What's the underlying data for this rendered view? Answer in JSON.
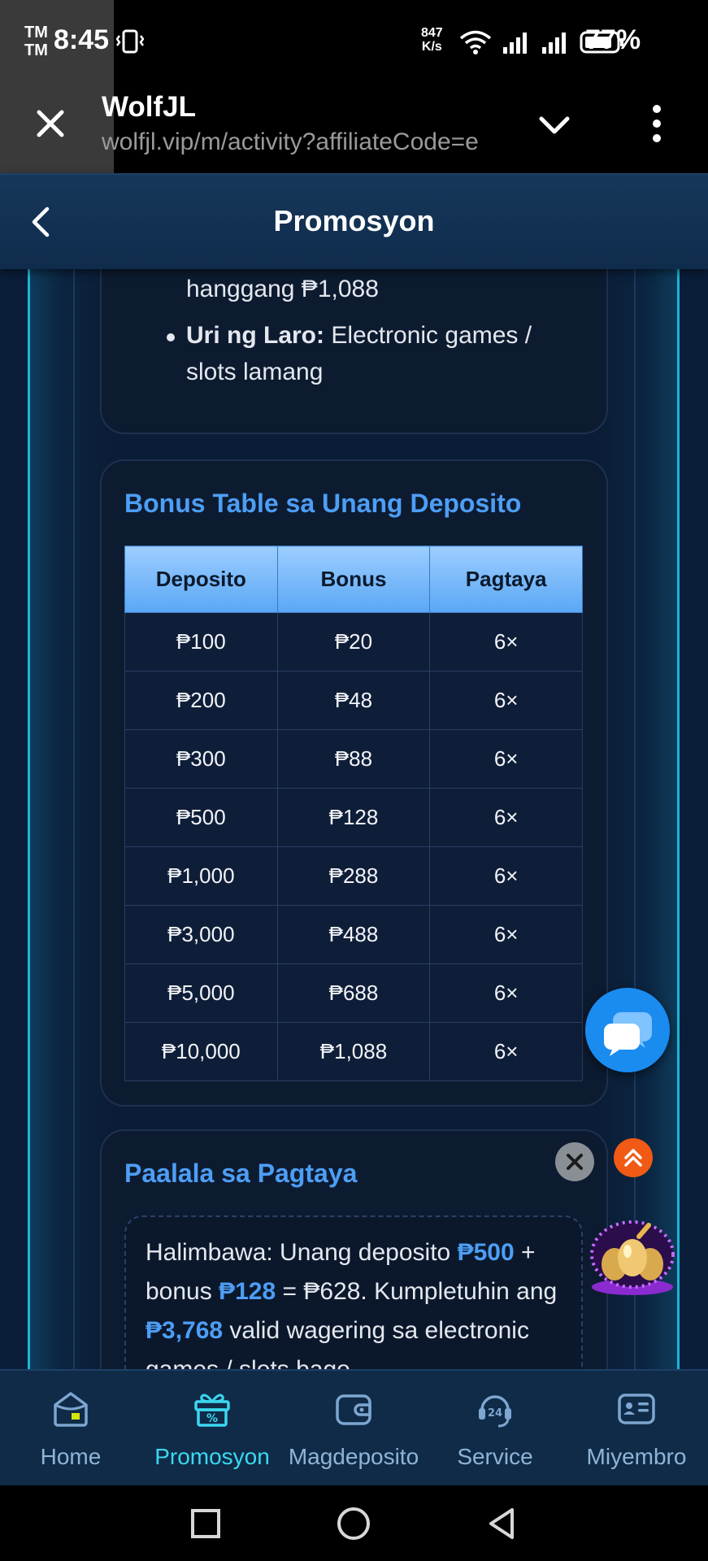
{
  "status_bar": {
    "tm_top": "TM",
    "tm_bottom": "TM",
    "time": "8:45",
    "vibrate_glyph": "〠",
    "net_speed_value": "847",
    "net_speed_unit": "K/s",
    "battery": "77%",
    "icons": [
      "vibrate-icon",
      "wifi-icon",
      "signal-icon",
      "signal-icon",
      "battery-icon"
    ]
  },
  "browser": {
    "title": "WolfJL",
    "url": "wolfjl.vip/m/activity?affiliateCode=e"
  },
  "header": {
    "title": "Promosyon"
  },
  "rules_card": {
    "line1": "hanggang ₱1,088",
    "bullet_label": "Uri ng Laro:",
    "bullet_text": " Electronic games /",
    "bullet_line2": "slots lamang"
  },
  "bonus_table": {
    "heading": "Bonus Table sa Unang Deposito",
    "columns": [
      "Deposito",
      "Bonus",
      "Pagtaya"
    ],
    "rows": [
      [
        "₱100",
        "₱20",
        "6×"
      ],
      [
        "₱200",
        "₱48",
        "6×"
      ],
      [
        "₱300",
        "₱88",
        "6×"
      ],
      [
        "₱500",
        "₱128",
        "6×"
      ],
      [
        "₱1,000",
        "₱288",
        "6×"
      ],
      [
        "₱3,000",
        "₱488",
        "6×"
      ],
      [
        "₱5,000",
        "₱688",
        "6×"
      ],
      [
        "₱10,000",
        "₱1,088",
        "6×"
      ]
    ]
  },
  "reminder": {
    "heading": "Paalala sa Pagtaya",
    "p1": "Halimbawa: Unang deposito ",
    "v1": "₱500",
    "p2": " + bonus ",
    "v2": "₱128",
    "p3": " = ₱628. Kumpletuhin ang ",
    "v3": "₱3,768",
    "p4": " valid wagering sa electronic games / slots bago"
  },
  "nav": {
    "items": [
      {
        "label": "Home",
        "icon": "home-icon",
        "active": false
      },
      {
        "label": "Promosyon",
        "icon": "gift-icon",
        "active": true
      },
      {
        "label": "Magdeposito",
        "icon": "wallet-icon",
        "active": false
      },
      {
        "label": "Service",
        "icon": "support-24-icon",
        "active": false
      },
      {
        "label": "Miyembro",
        "icon": "member-card-icon",
        "active": false
      }
    ]
  },
  "colors": {
    "accent": "#4d9ef5",
    "active_nav": "#3cd7f0",
    "frame_glow": "#1fb5d8",
    "background": "#0a1e3a"
  }
}
